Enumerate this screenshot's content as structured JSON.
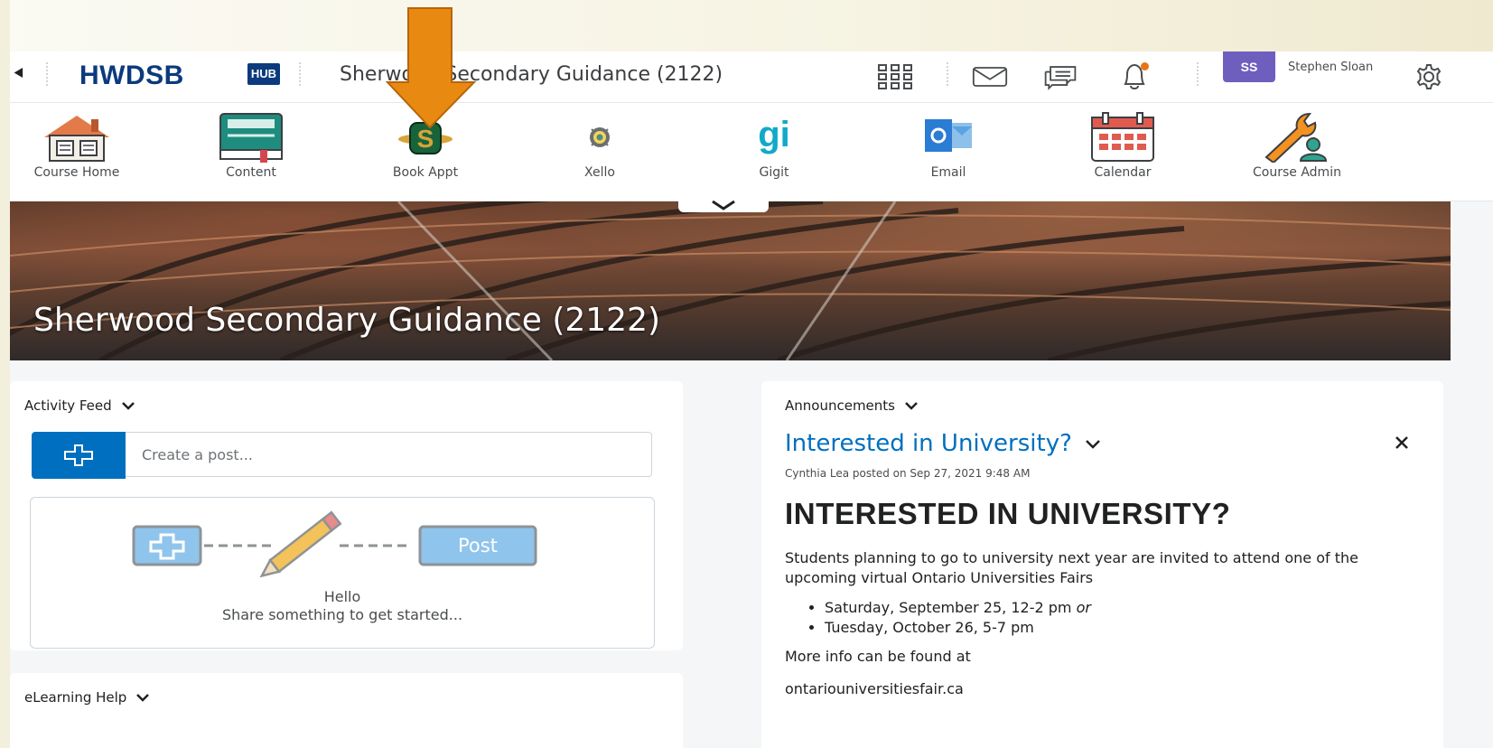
{
  "navbar": {
    "logo_text": "HWDSB",
    "logo_badge": "HUB",
    "course_title": "Sherwood Secondary Guidance (2122)",
    "user_initials": "SS",
    "user_name": "Stephen Sloan",
    "icons": [
      "back-icon",
      "app-grid-icon",
      "mail-icon",
      "chat-icon",
      "bell-icon",
      "gear-icon"
    ],
    "notification_dot_color": "#e87511",
    "avatar_color": "#6e5fbf",
    "brand_color": "#0b3a7d"
  },
  "launcher": {
    "tiles": [
      {
        "label": "Course Home",
        "icon": "house-icon"
      },
      {
        "label": "Content",
        "icon": "book-icon"
      },
      {
        "label": "Book Appt",
        "icon": "sherwood-s-icon"
      },
      {
        "label": "Xello",
        "icon": "xello-icon"
      },
      {
        "label": "Gigit",
        "icon": "gigit-icon"
      },
      {
        "label": "Email",
        "icon": "outlook-icon"
      },
      {
        "label": "Calendar",
        "icon": "calendar-icon"
      },
      {
        "label": "Course Admin",
        "icon": "wrench-icon"
      }
    ]
  },
  "banner": {
    "title": "Sherwood Secondary Guidance (2122)"
  },
  "activity_feed": {
    "title": "Activity Feed",
    "input_placeholder": "Create a post...",
    "post_label": "Post",
    "empty_line1": "Hello",
    "empty_line2": "Share something to get started..."
  },
  "elearning_help": {
    "title": "eLearning Help"
  },
  "announcements": {
    "widget_title": "Announcements",
    "item_title": "Interested in University?",
    "meta": "Cynthia Lea posted on Sep 27, 2021 9:48 AM",
    "heading": "INTERESTED IN UNIVERSITY?",
    "body": "Students planning to go to university next year are invited to attend one of the upcoming virtual Ontario Universities Fairs",
    "date1": "Saturday, September 25, 12-2 pm",
    "date1_suffix": "or",
    "date2": "Tuesday, October 26, 5-7 pm",
    "more_info": "More info can be found at",
    "link": "ontariouniversitiesfair.ca"
  },
  "colors": {
    "primary": "#006fbf",
    "arrow": "#e88a12"
  }
}
